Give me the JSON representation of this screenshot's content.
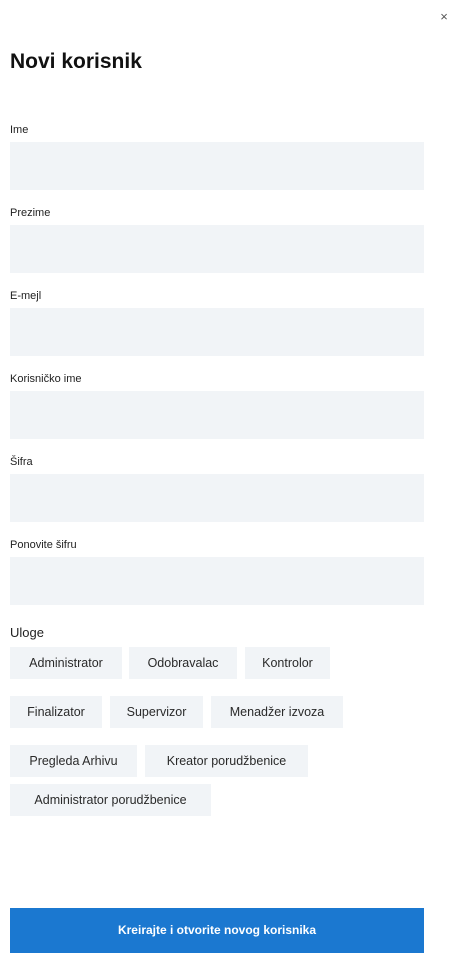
{
  "header": {
    "close_icon": "close-icon",
    "close_glyph": "×",
    "title": "Novi korisnik"
  },
  "form": {
    "fields": [
      {
        "label": "Ime",
        "value": "",
        "placeholder": ""
      },
      {
        "label": "Prezime",
        "value": "",
        "placeholder": ""
      },
      {
        "label": "E-mejl",
        "value": "",
        "placeholder": ""
      },
      {
        "label": "Korisničko ime",
        "value": "",
        "placeholder": ""
      },
      {
        "label": "Šifra",
        "value": "",
        "placeholder": ""
      },
      {
        "label": "Ponovite šifru",
        "value": "",
        "placeholder": ""
      }
    ]
  },
  "roles": {
    "label": "Uloge",
    "items": [
      "Administrator",
      "Odobravalac",
      "Kontrolor",
      "Finalizator",
      "Supervizor",
      "Menadžer izvoza",
      "Pregleda Arhivu",
      "Kreator porudžbenice",
      "Administrator porudžbenice"
    ]
  },
  "actions": {
    "submit_label": "Kreirajte i otvorite novog korisnika"
  },
  "colors": {
    "primary": "#1b78d0",
    "input_bg": "#f1f4f7",
    "text": "#1a1a1a"
  }
}
